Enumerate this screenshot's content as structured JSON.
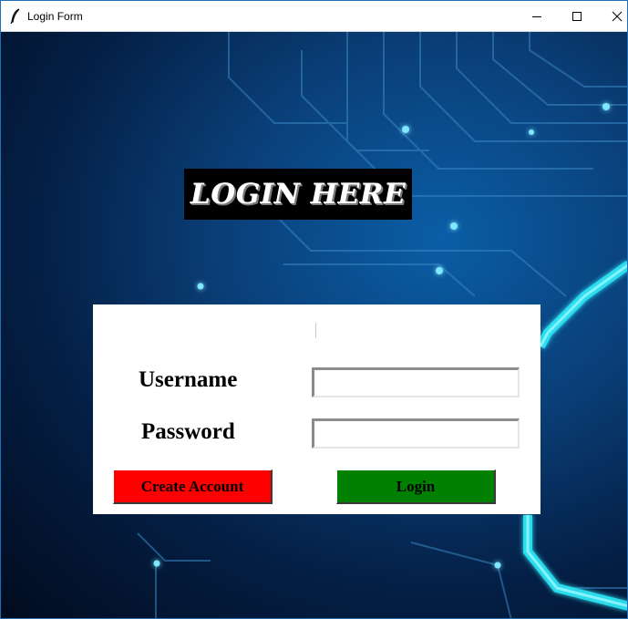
{
  "window": {
    "title": "Login Form",
    "icons": {
      "app": "feather-icon",
      "minimize": "minimize-icon",
      "maximize": "maximize-icon",
      "close": "close-icon"
    }
  },
  "heading": {
    "text": "LOGIN HERE"
  },
  "form": {
    "username_label": "Username",
    "password_label": "Password",
    "username_value": "",
    "password_value": ""
  },
  "buttons": {
    "create_account": "Create Account",
    "login": "Login"
  },
  "colors": {
    "create_account_bg": "#ff0000",
    "login_bg": "#008000",
    "heading_bg": "#000000",
    "panel_bg": "#ffffff"
  }
}
